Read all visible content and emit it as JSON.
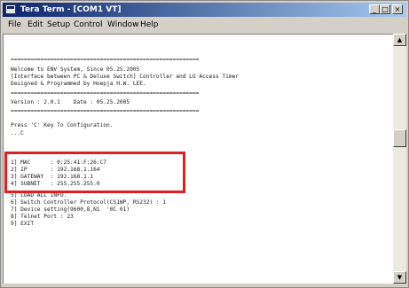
{
  "window": {
    "title": "Tera Term - [COM1 VT]",
    "controls": {
      "minimize": "_",
      "maximize": "□",
      "close": "×"
    }
  },
  "menu": [
    {
      "label": "File"
    },
    {
      "label": "Edit"
    },
    {
      "label": "Setup"
    },
    {
      "label": "Control"
    },
    {
      "label": "Window"
    },
    {
      "label": "Help"
    }
  ],
  "terminal": {
    "separator_1": "=========================================================",
    "welcome_1": "Welcome to ENV System, Since 05.25.2005",
    "welcome_2": "[Interface between PC & Deluxe Switch] Controller and LG Access Timer",
    "welcome_3": "Designed & Programmed by Hoepja H.W. LEE.",
    "separator_2": "=========================================================",
    "version": "Version : 2.0.1    Date : 05.25.2005",
    "separator_3": "=========================================================",
    "prompt_1": "Press 'C' Key To Configuration.",
    "prompt_2": "...C",
    "mac": "1] MAC      : 0:25:41:F:26:C7",
    "ip": "2] IP       : 192.168.1.164",
    "gateway": "3] GATEWAY  : 192.168.1.1",
    "subnet": "4] SUBNET   : 255.255.255.0",
    "load_all": "5] LOAD ALL INFO.",
    "switch_ctrl": "6] Switch Controller Protocol(CS1WP, RS232) : 1",
    "device_setting": "7] Device setting(9600,8,N1  '0C 01)",
    "telnet_port": "8] Telnet Port : 23",
    "exit": "9] EXIT"
  },
  "colors": {
    "highlight_border": "#e02020",
    "title_gradient_start": "#0a246a",
    "title_gradient_end": "#a6caf0"
  }
}
